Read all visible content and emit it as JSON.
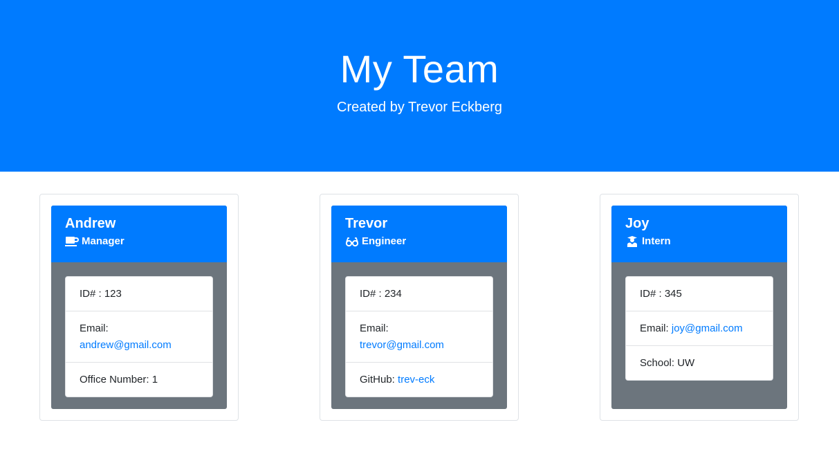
{
  "header": {
    "title": "My Team",
    "subtitle": "Created by Trevor Eckberg"
  },
  "colors": {
    "primary": "#007bff",
    "card_body": "#6c757d"
  },
  "team": [
    {
      "name": "Andrew",
      "role": "Manager",
      "role_icon": "mug-icon",
      "id_text": "ID# : 123",
      "email_label": "Email:",
      "email": "andrew@gmail.com",
      "extra_label": "Office Number:",
      "extra_value": "1"
    },
    {
      "name": "Trevor",
      "role": "Engineer",
      "role_icon": "glasses-icon",
      "id_text": "ID# : 234",
      "email_label": "Email:",
      "email": "trevor@gmail.com",
      "extra_label": "GitHub:",
      "extra_value": "trev-eck"
    },
    {
      "name": "Joy",
      "role": "Intern",
      "role_icon": "graduate-icon",
      "id_text": "ID# : 345",
      "email_label": "Email:",
      "email": "joy@gmail.com",
      "extra_label": "School:",
      "extra_value": "UW"
    }
  ]
}
